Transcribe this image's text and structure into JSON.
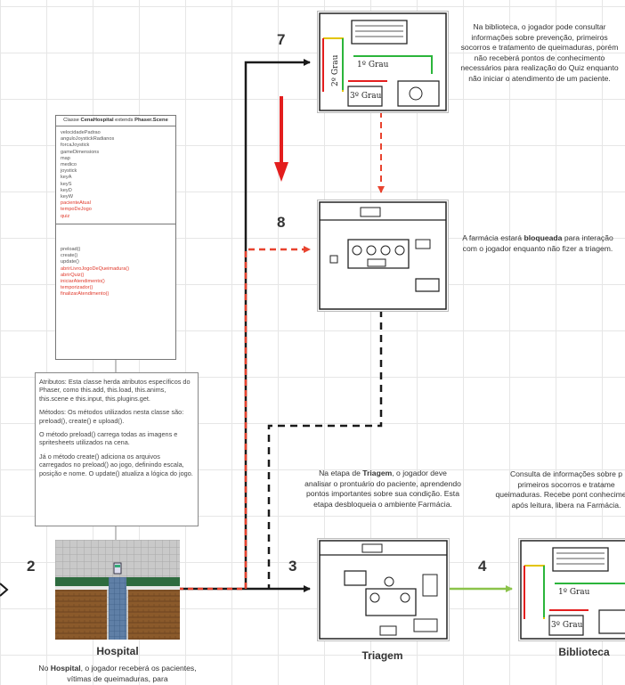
{
  "steps": {
    "s2": "2",
    "s3": "3",
    "s4": "4",
    "s7": "7",
    "s8": "8"
  },
  "rooms": {
    "hospital": "Hospital",
    "triagem": "Triagem",
    "biblioteca": "Biblioteca"
  },
  "notes": {
    "biblioteca_top": "Na biblioteca, o jogador pode consultar informações sobre prevenção, primeiros socorros e tratamento de queimaduras, porém não receberá pontos de conhecimento necessários para realização do Quiz enquanto não iniciar o atendimento de um paciente.",
    "farmacia_pre": "A farmácia estará ",
    "farmacia_bold": "bloqueada",
    "farmacia_post": " para interação com o jogador enquanto não fizer a triagem.",
    "triagem_pre": "Na etapa de ",
    "triagem_bold": "Triagem",
    "triagem_post": ", o jogador deve analisar o prontuário do paciente, aprendendo pontos importantes sobre sua condição. Esta etapa desbloqueia o ambiente Farmácia.",
    "consulta": "Consulta de informações sobre p primeiros socorros e tratame queimaduras. Recebe pont conhecimento após leitura, libera na Farmácia.",
    "hospital_pre": "No ",
    "hospital_bold": "Hospital",
    "hospital_post": ", o jogador receberá os pacientes, vítimas de queimaduras, para"
  },
  "uml": {
    "title_pre": "Classe ",
    "title_class": "CenaHospital",
    "title_mid": " extends ",
    "title_parent": "Phaser.Scene",
    "attributes": [
      "velocidadePadrao",
      "anguloJoystickRadianos",
      "forcaJoystick",
      "gameDimensions",
      "map",
      "medico",
      "joystick",
      "keyA",
      "keyS",
      "keyD",
      "keyW"
    ],
    "attributes_red": [
      "pacienteAtual",
      "tempoDeJogo",
      "quiz"
    ],
    "methods": [
      "preload()",
      "create()",
      "update()"
    ],
    "methods_red": [
      "abrirLivroJogoDeQueimadura()",
      "abrirQuiz()",
      "iniciarAtendimento()",
      "temporizador()",
      "finalizarAtendimento()"
    ]
  },
  "description": {
    "p1": "Atributos: Esta classe herda atributos específicos do Phaser, como this.add, this.load, this.anims, this.scene e this.input, this.plugins.get.",
    "p2": "Métodos: Os métodos utilizados nesta classe são: preload(), create() e upload().",
    "p3": "O método preload() carrega todas as imagens e spritesheets utilizados na cena.",
    "p4": "Já o método create() adiciona os arquivos carregados no preload() ao jogo, definindo escala, posição e nome. O update() atualiza a lógica do jogo."
  },
  "sketch_text": {
    "shelf_label": "1º Grau",
    "shelf_label2": "3º Grau",
    "shelf_label3": "2º Grau"
  },
  "colors": {
    "flow_black": "#1a1a1a",
    "flow_red": "#e8432f",
    "flow_green": "#8bc34a",
    "big_arrow_red": "#e31e1e"
  }
}
